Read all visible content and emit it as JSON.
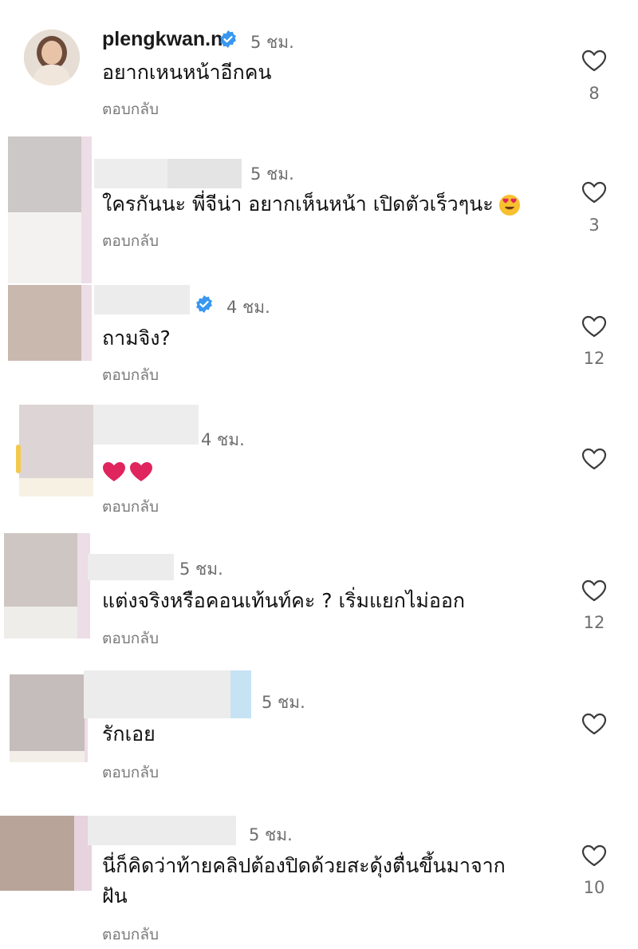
{
  "comments": [
    {
      "username": "plengkwan.n",
      "verified": true,
      "time": "5 ชม.",
      "text": "อยากเหนหน้าอีกคน",
      "reply": "ตอบกลับ",
      "likes": "8"
    },
    {
      "username": "",
      "verified": false,
      "time": "5 ชม.",
      "text": "ใครกันนะ พี่จีน่า อยากเห็นหน้า เปิดตัวเร็วๆนะ",
      "emoji": "heart-eyes",
      "reply": "ตอบกลับ",
      "likes": "3"
    },
    {
      "username": "",
      "verified": true,
      "time": "4 ชม.",
      "text": "ถามจิง?",
      "reply": "ตอบกลับ",
      "likes": "12"
    },
    {
      "username": "",
      "verified": false,
      "time": "4 ชม.",
      "text": "",
      "emoji": "red-hearts",
      "reply": "ตอบกลับ",
      "likes": ""
    },
    {
      "username": "",
      "verified": false,
      "time": "5 ชม.",
      "text": "แต่งจริงหรือคอนเท้นท์คะ ? เริ่มแยกไม่ออก",
      "reply": "ตอบกลับ",
      "likes": "12"
    },
    {
      "username": "",
      "verified": false,
      "time": "5 ชม.",
      "text": "รักเอย",
      "reply": "ตอบกลับ",
      "likes": ""
    },
    {
      "username": "",
      "verified": false,
      "time": "5 ชม.",
      "text_line1": "นี่ก็คิดว่าท้ายคลิปต้องปิดด้วยสะดุ้งตื่นขึ้นมาจาก",
      "text_line2": "ฝัน",
      "reply": "ตอบกลับ",
      "likes": "10"
    }
  ],
  "colors": {
    "verified": "#3897f0",
    "heart_stroke": "#3a3a3a",
    "emoji_red": "#e0245e"
  },
  "icons": {
    "like": "heart-outline-icon",
    "verified": "verified-badge-icon"
  }
}
